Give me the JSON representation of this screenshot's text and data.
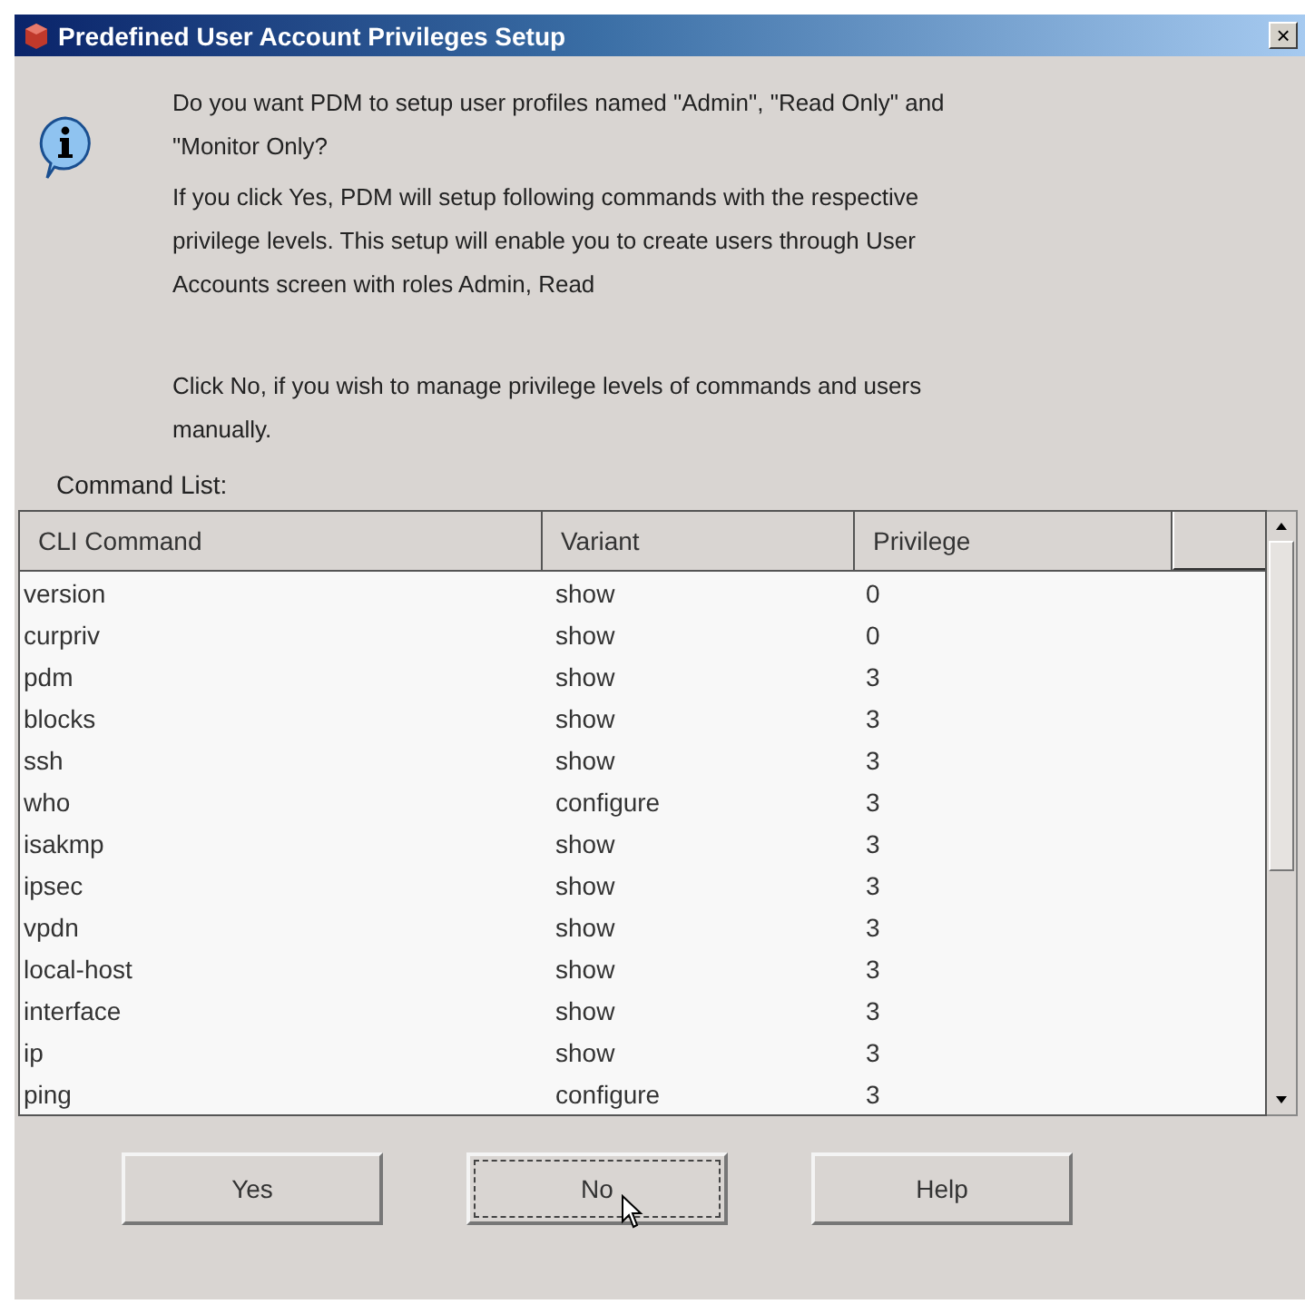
{
  "window": {
    "title": "Predefined User Account Privileges Setup",
    "close": "×"
  },
  "message": {
    "paragraphs": [
      "Do you want PDM to setup user profiles named \"Admin\", \"Read Only\" and \"Monitor Only?",
      "If you click Yes, PDM will setup following commands with the respective privilege levels. This setup will enable you to create users through User Accounts screen with roles Admin, Read",
      "Click No, if you wish to manage privilege levels of commands and users manually."
    ]
  },
  "command_list": {
    "label": "Command List:",
    "columns": [
      "CLI Command",
      "Variant",
      "Privilege"
    ],
    "rows": [
      [
        "version",
        "show",
        "0"
      ],
      [
        "curpriv",
        "show",
        "0"
      ],
      [
        "pdm",
        "show",
        "3"
      ],
      [
        "blocks",
        "show",
        "3"
      ],
      [
        "ssh",
        "show",
        "3"
      ],
      [
        "who",
        "configure",
        "3"
      ],
      [
        "isakmp",
        "show",
        "3"
      ],
      [
        "ipsec",
        "show",
        "3"
      ],
      [
        "vpdn",
        "show",
        "3"
      ],
      [
        "local-host",
        "show",
        "3"
      ],
      [
        "interface",
        "show",
        "3"
      ],
      [
        "ip",
        "show",
        "3"
      ],
      [
        "ping",
        "configure",
        "3"
      ]
    ]
  },
  "buttons": [
    {
      "label": "Yes",
      "focused": false
    },
    {
      "label": "No",
      "focused": true
    },
    {
      "label": "Help",
      "focused": false
    }
  ]
}
